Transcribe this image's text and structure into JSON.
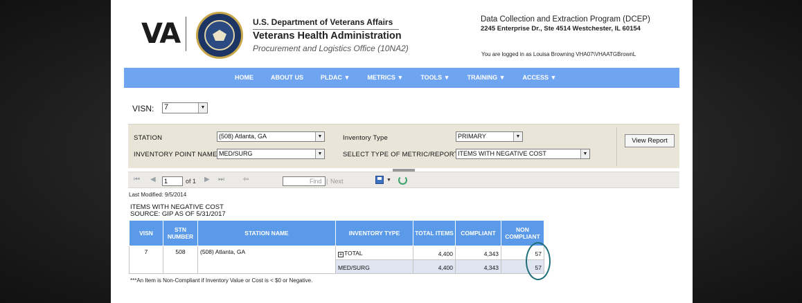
{
  "header": {
    "logo_text": "VA",
    "org_line1": "U.S. Department of Veterans Affairs",
    "org_line2": "Veterans Health Administration",
    "org_line3": "Procurement and Logistics Office (10NA2)",
    "program_title": "Data Collection and Extraction Program (DCEP)",
    "program_address": "2245 Enterprise Dr., Ste 4514 Westchester, IL 60154",
    "login_text": "You are logged in as Louisa Browning VHA07\\VHAATGBrownL"
  },
  "nav": {
    "items": [
      "HOME",
      "ABOUT US",
      "PLDAC ▼",
      "METRICS ▼",
      "TOOLS ▼",
      "TRAINING ▼",
      "ACCESS ▼"
    ],
    "color": "#6fa5f0"
  },
  "visn": {
    "label": "VISN:",
    "value": "7"
  },
  "params": {
    "station_label": "STATION",
    "station_value": "(508) Atlanta, GA",
    "inv_type_label": "Inventory Type",
    "inv_type_value": "PRIMARY",
    "inv_point_label": "INVENTORY POINT NAME",
    "inv_point_value": "MED/SURG",
    "metric_label": "SELECT TYPE OF METRIC/REPORT:",
    "metric_value": "ITEMS WITH NEGATIVE COST",
    "view_report": "View Report"
  },
  "toolbar": {
    "page_value": "1",
    "of_text": "of 1",
    "find": "Find",
    "separator": "|",
    "next": "Next"
  },
  "report": {
    "last_modified": "Last Modified: 9/5/2014",
    "title": "ITEMS WITH NEGATIVE COST",
    "source": "SOURCE: GIP AS OF 5/31/2017",
    "columns": [
      "VISN",
      "STN NUMBER",
      "STATION NAME",
      "INVENTORY TYPE",
      "TOTAL ITEMS",
      "COMPLIANT",
      "NON COMPLIANT"
    ],
    "row_total": {
      "visn": "7",
      "stn": "508",
      "station": "(508) Atlanta, GA",
      "inv_type": "TOTAL",
      "total": "4,400",
      "compliant": "4,343",
      "non_compliant": "57"
    },
    "row_sub": {
      "inv_type": "MED/SURG",
      "total": "4,400",
      "compliant": "4,343",
      "non_compliant": "57"
    },
    "footnote": "***An Item is Non-Compliant if Inventory Value or Cost is < $0 or Negative.",
    "header_color": "#5a9ae8",
    "highlight_color": "#1e6e7a"
  }
}
